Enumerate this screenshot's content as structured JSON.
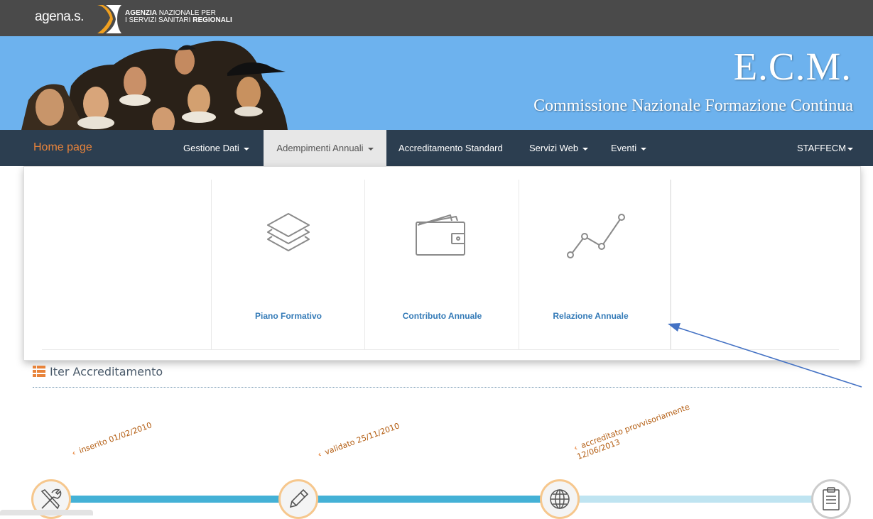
{
  "header": {
    "brand": "agena.s.",
    "org_line1_bold": "AGENZIA",
    "org_line1_rest": " NAZIONALE PER",
    "org_line2_rest": "I SERVIZI SANITARI ",
    "org_line2_bold": "REGIONALI"
  },
  "banner": {
    "title": "E.C.M.",
    "subtitle": "Commissione Nazionale Formazione Continua"
  },
  "nav": {
    "home": "Home page",
    "items": [
      {
        "label": "Gestione Dati",
        "dropdown": true
      },
      {
        "label": "Adempimenti Annuali",
        "dropdown": true,
        "active": true
      },
      {
        "label": "Accreditamento Standard",
        "dropdown": false
      },
      {
        "label": "Servizi Web",
        "dropdown": true
      },
      {
        "label": "Eventi",
        "dropdown": true
      }
    ],
    "user": "STAFFECM"
  },
  "menu": {
    "items": [
      {
        "label": "Piano Formativo",
        "icon": "layers-icon"
      },
      {
        "label": "Contributo Annuale",
        "icon": "wallet-icon"
      },
      {
        "label": "Relazione Annuale",
        "icon": "line-chart-icon"
      }
    ]
  },
  "iter": {
    "title": "Iter Accreditamento",
    "steps": [
      {
        "label": "inserito 01/02/2010",
        "icon": "tools-icon",
        "status": "done"
      },
      {
        "label": "validato 25/11/2010",
        "icon": "pencil-icon",
        "status": "done"
      },
      {
        "label": "accreditato provvisoriamente",
        "label2": "12/06/2013",
        "icon": "globe-icon",
        "status": "done"
      },
      {
        "label": "",
        "icon": "clipboard-icon",
        "status": "pending"
      }
    ]
  },
  "colors": {
    "topbar": "#4a4a4a",
    "banner": "#6db2ee",
    "navbar": "#2c3e50",
    "home_link": "#e8833a",
    "menu_link": "#337ab7",
    "timeline_done": "#44b1d6",
    "timeline_pending": "#bfe4f1",
    "step_label": "#b35c10"
  }
}
